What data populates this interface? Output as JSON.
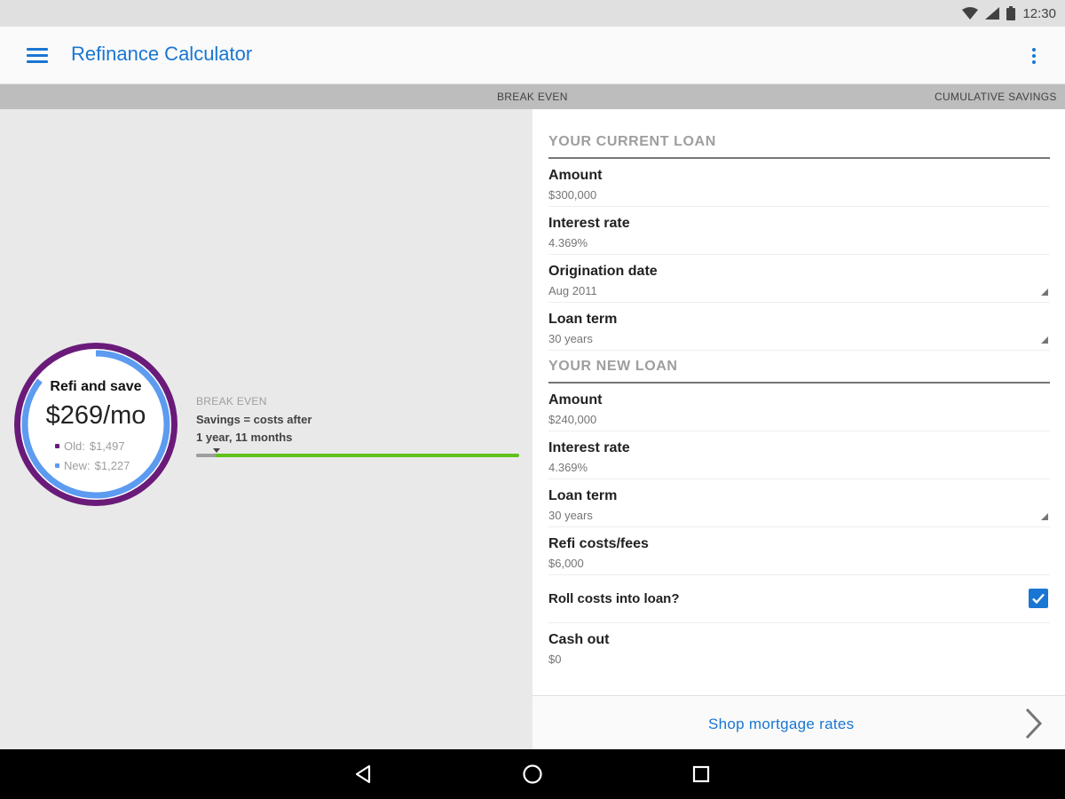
{
  "status_bar": {
    "time": "12:30",
    "icons": [
      "wifi-icon",
      "signal-icon",
      "battery-icon"
    ]
  },
  "app_bar": {
    "title": "Refinance Calculator",
    "menu_icon": "menu-icon",
    "overflow_icon": "more-vert-icon"
  },
  "tabs": [
    {
      "label": "BREAK EVEN"
    },
    {
      "label": "CUMULATIVE SAVINGS"
    }
  ],
  "summary": {
    "title": "Refi and save",
    "amount": "$269/mo",
    "old_label": "Old:",
    "old_value": "$1,497",
    "new_label": "New:",
    "new_value": "$1,227",
    "colors": {
      "old": "#6a1b7a",
      "new": "#5c9bf0"
    }
  },
  "break_even": {
    "label": "BREAK EVEN",
    "line1": "Savings = costs after",
    "line2": "1 year, 11 months"
  },
  "current_loan": {
    "header": "YOUR CURRENT LOAN",
    "fields": [
      {
        "label": "Amount",
        "value": "$300,000"
      },
      {
        "label": "Interest rate",
        "value": "4.369%"
      },
      {
        "label": "Origination date",
        "value": "Aug 2011"
      },
      {
        "label": "Loan term",
        "value": "30 years"
      }
    ]
  },
  "new_loan": {
    "header": "YOUR NEW LOAN",
    "fields": [
      {
        "label": "Amount",
        "value": "$240,000"
      },
      {
        "label": "Interest rate",
        "value": "4.369%"
      },
      {
        "label": "Loan term",
        "value": "30 years"
      },
      {
        "label": "Refi costs/fees",
        "value": "$6,000"
      }
    ],
    "roll_costs_label": "Roll costs into loan?",
    "roll_costs_checked": true,
    "cash_out_label": "Cash out",
    "cash_out_value": "$0"
  },
  "footer": {
    "link": "Shop mortgage rates"
  },
  "nav_bar": {
    "icons": [
      "back-icon",
      "home-icon",
      "recents-icon"
    ]
  }
}
